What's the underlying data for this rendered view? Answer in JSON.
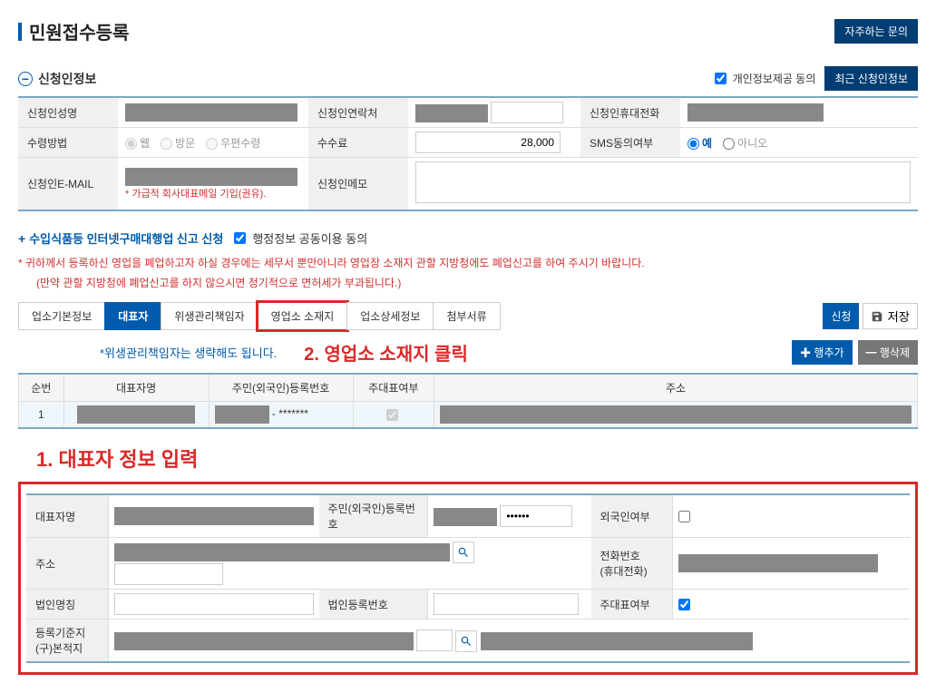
{
  "header": {
    "title": "민원접수등록",
    "faq_button": "자주하는 문의"
  },
  "applicant": {
    "section_title": "신청인정보",
    "privacy_label": "개인정보제공 동의",
    "recent_button": "최근 신청인정보",
    "labels": {
      "name": "신청인성명",
      "contact": "신청인연락처",
      "mobile": "신청인휴대전화",
      "receive": "수령방법",
      "fee": "수수료",
      "sms": "SMS동의여부",
      "email": "신청인E-MAIL",
      "memo": "신청인메모"
    },
    "receive_options": {
      "web": "웹",
      "visit": "방문",
      "post": "우편수령"
    },
    "fee_value": "28,000",
    "sms_options": {
      "yes": "예",
      "no": "아니오"
    },
    "email_hint": "* 가급적 회사대표메일 기입(권유)."
  },
  "request": {
    "title": "수입식품등 인터넷구매대행업 신고 신청",
    "share_label": "행정정보 공동이용 동의",
    "warning1": "* 귀하께서 등록하신 영업을 폐업하고자 하실 경우에는 세무서 뿐만아니라 영업장 소재지 관할 지방청에도 폐업신고를 하여 주시기 바랍니다.",
    "warning2": "(만약 관할 지방청에 폐업신고를 하지 않으시면 정기적으로 면허세가 부과됩니다.)"
  },
  "tabs": {
    "t1": "업소기본정보",
    "t2": "대표자",
    "t3": "위생관리책임자",
    "t4": "영업소 소재지",
    "t5": "업소상세정보",
    "t6": "첨부서류"
  },
  "actions": {
    "apply": "신청",
    "save": "저장",
    "add_row": "행추가",
    "del_row": "행삭제"
  },
  "note_text": "*위생관리책임자는 생략해도 됩니다.",
  "annotation2": "2. 영업소 소재지 클릭",
  "annotation1": "1. 대표자 정보 입력",
  "grid": {
    "headers": {
      "seq": "순번",
      "name": "대표자명",
      "rrn": "주민(외국인)등록번호",
      "primary": "주대표여부",
      "addr": "주소"
    },
    "row1": {
      "seq": "1",
      "rrn_mask": "- *******"
    }
  },
  "detail": {
    "labels": {
      "name": "대표자명",
      "rrn": "주민(외국인)등록번호",
      "foreigner": "외국인여부",
      "addr": "주소",
      "phone": "전화번호\n(휴대전화)",
      "corp": "법인명칭",
      "corp_no": "법인등록번호",
      "primary": "주대표여부",
      "reg_base": "등록기준지\n(구)본적지"
    },
    "rrn_mask": "••••••"
  }
}
